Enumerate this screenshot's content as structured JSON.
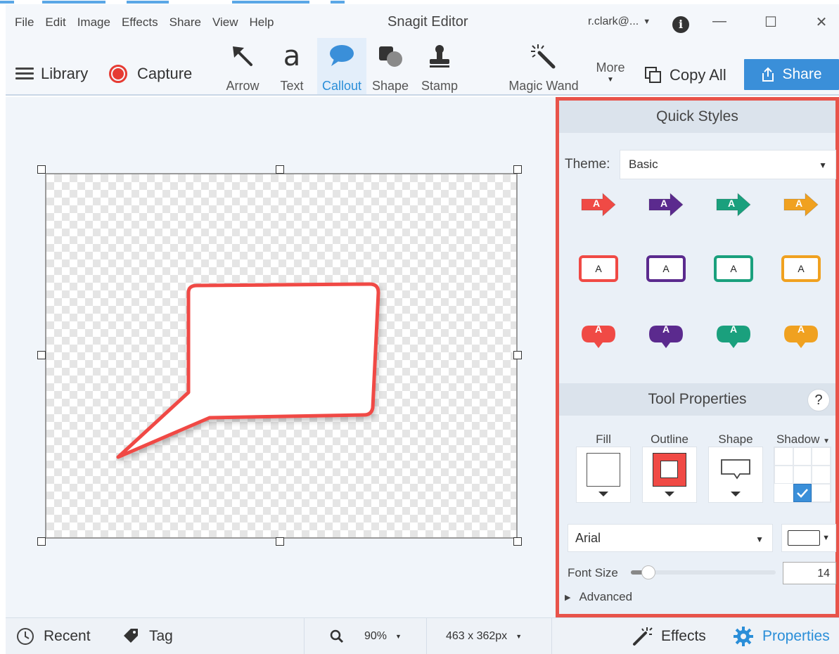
{
  "menu": [
    "File",
    "Edit",
    "Image",
    "Effects",
    "Share",
    "View",
    "Help"
  ],
  "app_title": "Snagit Editor",
  "account": "r.clark@...",
  "window_controls": {
    "minimize": "—",
    "maximize": "☐",
    "close": "✕"
  },
  "toolbar": {
    "library_label": "Library",
    "capture_label": "Capture",
    "tools": [
      {
        "label": "Arrow",
        "icon": "arrow-icon"
      },
      {
        "label": "Text",
        "icon": "text-icon"
      },
      {
        "label": "Callout",
        "icon": "callout-icon",
        "active": true
      },
      {
        "label": "Shape",
        "icon": "shape-icon"
      },
      {
        "label": "Stamp",
        "icon": "stamp-icon"
      },
      {
        "label": "Magic Wand",
        "icon": "magic-wand-icon"
      }
    ],
    "more_label": "More",
    "copy_all_label": "Copy All",
    "share_label": "Share"
  },
  "properties_panel": {
    "quick_styles_title": "Quick Styles",
    "theme_label": "Theme:",
    "theme_value": "Basic",
    "style_letter": "A",
    "style_colors": [
      "#f04a45",
      "#5b2a8e",
      "#1aa07d",
      "#f0a120"
    ],
    "style_rows": [
      "arrow",
      "box",
      "bubble"
    ],
    "tool_properties_title": "Tool Properties",
    "help_label": "?",
    "fill_label": "Fill",
    "outline_label": "Outline",
    "shape_label": "Shape",
    "shadow_label": "Shadow",
    "font_value": "Arial",
    "font_size_label": "Font Size",
    "font_size_value": "14",
    "font_size_slider_fraction": 0.1,
    "advanced_label": "Advanced"
  },
  "status": {
    "recent_label": "Recent",
    "tag_label": "Tag",
    "zoom_value": "90%",
    "dimensions_value": "463 x 362px",
    "effects_label": "Effects",
    "properties_label": "Properties"
  },
  "colors": {
    "accent": "#3a8fd9",
    "callout_outline": "#f04a45",
    "panel_highlight": "#e8534a"
  }
}
